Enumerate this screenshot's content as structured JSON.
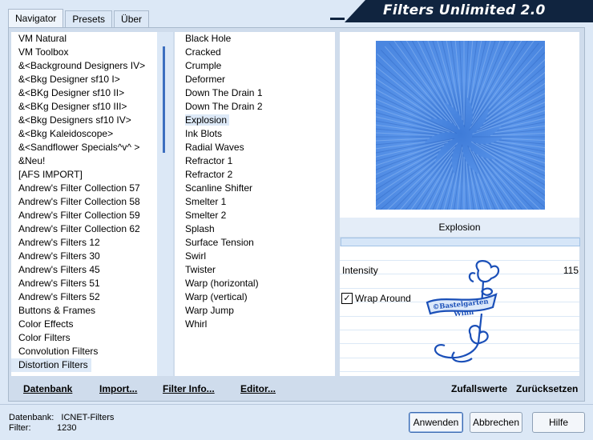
{
  "app": {
    "title": "Filters Unlimited 2.0"
  },
  "tabs": [
    "Navigator",
    "Presets",
    "Über"
  ],
  "categories": [
    "VM Natural",
    "VM Toolbox",
    "&<Background Designers IV>",
    "&<Bkg Designer sf10 I>",
    "&<BKg Designer sf10 II>",
    "&<BKg Designer sf10 III>",
    "&<Bkg Designers sf10 IV>",
    "&<Bkg Kaleidoscope>",
    "&<Sandflower Specials^v^ >",
    "&Neu!",
    "[AFS IMPORT]",
    "Andrew's Filter Collection 57",
    "Andrew's Filter Collection 58",
    "Andrew's Filter Collection 59",
    "Andrew's Filter Collection 62",
    "Andrew's Filters 12",
    "Andrew's Filters 30",
    "Andrew's Filters 45",
    "Andrew's Filters 51",
    "Andrew's Filters 52",
    "Buttons & Frames",
    "Color Effects",
    "Color Filters",
    "Convolution Filters",
    "Distortion Filters"
  ],
  "selected_category": "Distortion Filters",
  "filters": [
    "Black Hole",
    "Cracked",
    "Crumple",
    "Deformer",
    "Down The Drain 1",
    "Down The Drain 2",
    "Explosion",
    "Ink Blots",
    "Radial Waves",
    "Refractor 1",
    "Refractor 2",
    "Scanline Shifter",
    "Smelter 1",
    "Smelter 2",
    "Splash",
    "Surface Tension",
    "Swirl",
    "Twister",
    "Warp (horizontal)",
    "Warp (vertical)",
    "Warp Jump",
    "Whirl"
  ],
  "selected_filter": "Explosion",
  "preview": {
    "filter_name": "Explosion"
  },
  "params": {
    "intensity_label": "Intensity",
    "intensity_value": "115",
    "wrap_label": "Wrap Around",
    "wrap_checked": true,
    "check_mark": "✓"
  },
  "watermark": {
    "line1": "©Bastelgarten",
    "line2": "Winn"
  },
  "tools": {
    "datenbank": "Datenbank",
    "import": "Import...",
    "filter_info": "Filter Info...",
    "editor": "Editor...",
    "random": "Zufallswerte",
    "reset": "Zurücksetzen"
  },
  "info": {
    "db_label": "Datenbank:",
    "db_value": "ICNET-Filters",
    "filter_label": "Filter:",
    "filter_value": "1230"
  },
  "buttons": {
    "apply": "Anwenden",
    "cancel": "Abbrechen",
    "help": "Hilfe"
  },
  "colors": {
    "banner": "#10243f",
    "preview": "#4a86e0",
    "accent": "#3d6fbf"
  }
}
